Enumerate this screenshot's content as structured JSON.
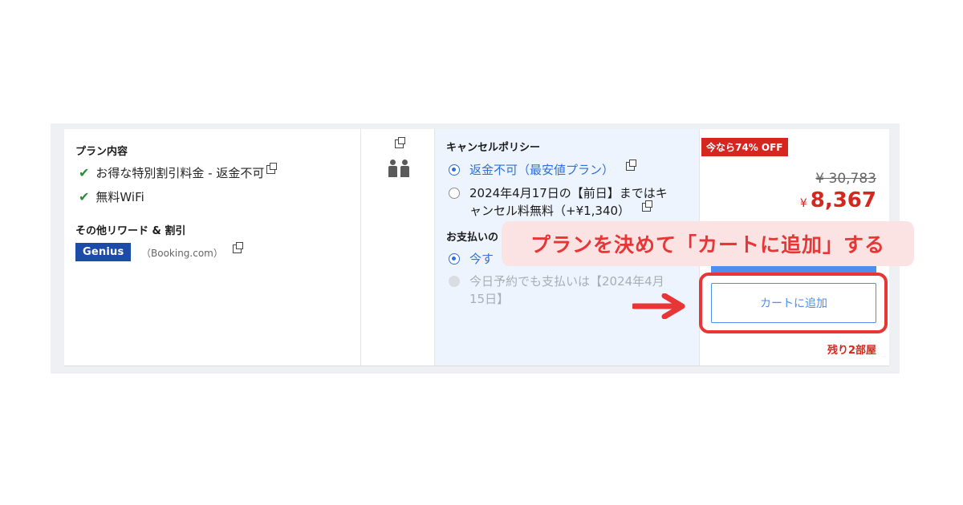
{
  "plan": {
    "title": "プラン内容",
    "features": [
      "お得な特別割引料金 - 返金不可",
      "無料WiFi"
    ],
    "other_title": "その他リワード & 割引",
    "genius_label": "Genius",
    "booking_label": "（Booking.com）"
  },
  "cancel": {
    "title": "キャンセルポリシー",
    "options": [
      {
        "text": "返金不可（最安値プラン）",
        "selected": true
      },
      {
        "line1": "2024年4月17日の【前日】まではキ",
        "line2": "ャンセル料無料（+¥1,340）",
        "selected": false
      }
    ],
    "payment_title": "お支払いの",
    "payment_options": [
      {
        "text": "今す",
        "selected": true
      },
      {
        "line1": "今日予約でも支払いは【2024年4月",
        "line2": "15日】",
        "disabled": true
      }
    ]
  },
  "price": {
    "badge": "今なら74% OFF",
    "original": "¥ 30,783",
    "currency": "¥",
    "current": "8,367",
    "cart_button": "カートに追加",
    "remaining": "残り2部屋"
  },
  "annotation": {
    "callout": "プランを決めて「カートに追加」する",
    "accent_color": "#e83535"
  }
}
